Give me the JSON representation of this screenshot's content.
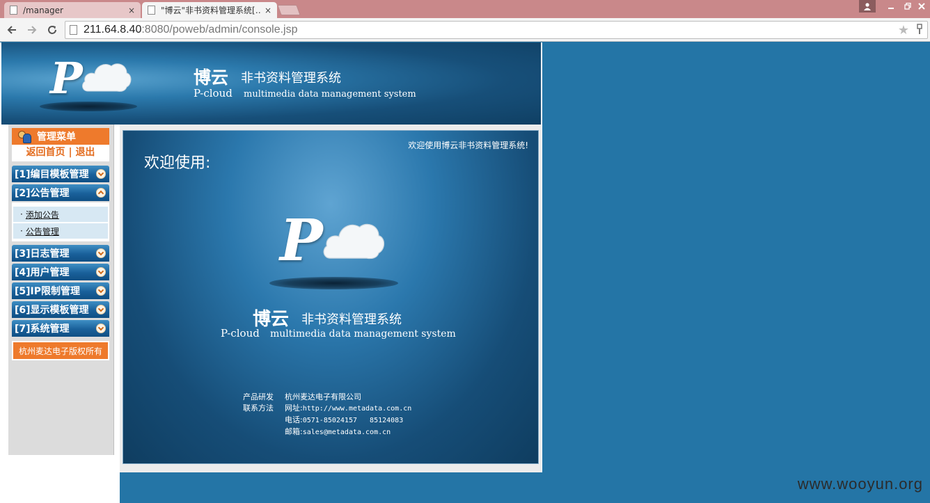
{
  "browser": {
    "tabs": [
      {
        "title": "/manager",
        "active": false
      },
      {
        "title": "\"博云\"非书资料管理系统[…",
        "active": true
      }
    ],
    "close_glyph": "×",
    "url_host": "211.64.8.40",
    "url_rest": ":8080/poweb/admin/console.jsp",
    "icons": [
      "back-icon",
      "forward-icon",
      "reload-icon",
      "page-icon",
      "star-icon",
      "extension-icon",
      "user-icon",
      "minimize-icon",
      "restore-icon",
      "close-icon"
    ]
  },
  "brand": {
    "name_cn": "博云",
    "subtitle_cn": "非书资料管理系统",
    "name_en": "P-cloud",
    "subtitle_en": "multimedia data management system",
    "logo_letter": "P"
  },
  "sidebar": {
    "header": "管理菜单",
    "link_home": "返回首页",
    "link_sep": "|",
    "link_logout": "退出",
    "items": [
      {
        "label": "[1]编目模板管理",
        "expanded": false
      },
      {
        "label": "[2]公告管理",
        "expanded": true
      },
      {
        "label": "[3]日志管理",
        "expanded": false
      },
      {
        "label": "[4]用户管理",
        "expanded": false
      },
      {
        "label": "[5]IP限制管理",
        "expanded": false
      },
      {
        "label": "[6]显示模板管理",
        "expanded": false
      },
      {
        "label": "[7]系统管理",
        "expanded": false
      }
    ],
    "subitems": [
      "添加公告",
      "公告管理"
    ],
    "bullet": "·",
    "copyright": "杭州麦达电子版权所有"
  },
  "content": {
    "welcome_top": "欢迎使用博云非书资料管理系统!",
    "welcome_big": "欢迎使用:",
    "contact": {
      "dev_label": "产品研发",
      "dev_value": "杭州麦达电子有限公司",
      "contact_label": "联系方法",
      "web_label": "网址:",
      "web_value": "http://www.metadata.com.cn",
      "phone_label": "电话:",
      "phone_value": "0571-85024157   85124083",
      "mail_label": "邮箱:",
      "mail_value": "sales@metadata.com.cn"
    }
  },
  "watermark": "www.wooyun.org",
  "colors": {
    "page_bg": "#2475a6",
    "accent_orange": "#ee7a2c",
    "menu_blue": "#19609a",
    "tabstrip": "#c9888a"
  }
}
